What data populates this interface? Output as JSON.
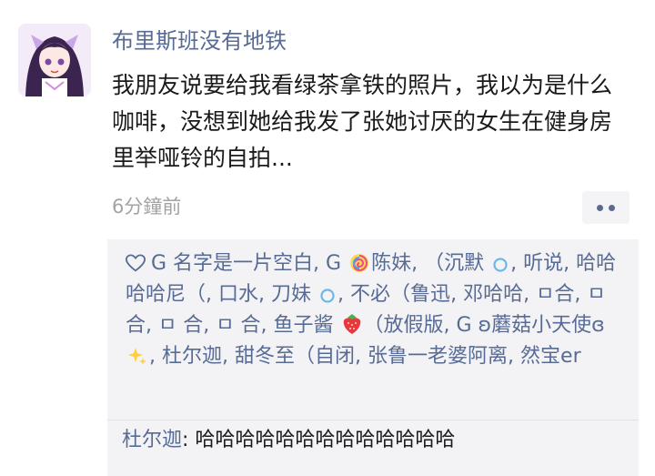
{
  "post": {
    "username": "布里斯班没有地铁",
    "text": "我朋友说要给我看绿茶拿铁的照片，我以为是什么咖啡，没想到她给我发了张她讨厌的女生在健身房里举哑铃的自拍...",
    "timestamp": "6分鐘前"
  },
  "likes": {
    "names": [
      "G 名字是一片空白",
      "G",
      "陈妹",
      "（沉默",
      "听说",
      "哈哈哈哈尼（",
      "口水",
      "刀妹",
      "不必（鲁迅",
      "邓哈哈",
      "ㅁ合",
      "ㅁ合",
      "ㅁ 合",
      "ㅁ 合",
      "鱼子酱",
      "（放假版",
      "G ʚ蘑菇小天使ɞ",
      "杜尔迦",
      "甜冬至（自闭",
      "张鲁一老婆阿离",
      "然宝er"
    ]
  },
  "comments": [
    {
      "name": "杜尔迦",
      "text": "哈哈哈哈哈哈哈哈哈哈哈哈哈"
    },
    {
      "name": "",
      "text": ""
    }
  ],
  "icons": {
    "heart": "heart-icon",
    "more": "more-dots-icon",
    "lollipop": "lollipop-icon",
    "circle": "blue-circle-icon",
    "strawberry": "strawberry-icon",
    "sparkles": "sparkles-icon"
  },
  "colors": {
    "link": "#576b95",
    "text": "#1a1a1a",
    "meta": "#a3a3a3",
    "panel": "#f3f3f5"
  }
}
